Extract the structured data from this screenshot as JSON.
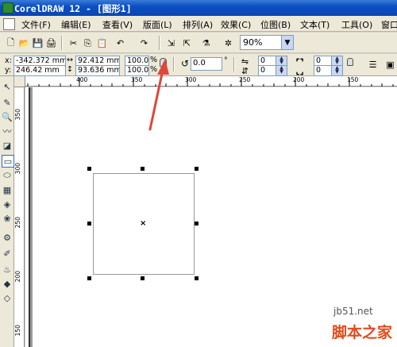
{
  "window": {
    "title": "CorelDRAW 12 - [图形1]"
  },
  "menu": [
    {
      "label": "文件(F)"
    },
    {
      "label": "编辑(E)"
    },
    {
      "label": "查看(V)"
    },
    {
      "label": "版面(L)"
    },
    {
      "label": "排列(A)"
    },
    {
      "label": "效果(C)"
    },
    {
      "label": "位图(B)"
    },
    {
      "label": "文本(T)"
    },
    {
      "label": "工具(O)"
    },
    {
      "label": "窗口"
    }
  ],
  "toolbar": {
    "icons": [
      "new-icon",
      "open-icon",
      "save-icon",
      "print-icon",
      "cut-icon",
      "copy-icon",
      "paste-icon",
      "undo-icon",
      "redo-icon",
      "import-icon",
      "export-icon",
      "app-launcher-icon",
      "corel-online-icon"
    ],
    "zoom": "90%"
  },
  "propbar": {
    "x_label": "x:",
    "x_value": "-342.372 mm",
    "y_label": "y:",
    "y_value": "246.42 mm",
    "w_value": "92.412 mm",
    "h_value": "93.636 mm",
    "scale_x": "100.0",
    "scale_y": "100.0",
    "percent_x": "%",
    "percent_y": "%",
    "rotate_value": "0.0",
    "degree": "°",
    "corner_tl": "0",
    "corner_bl": "0",
    "corner_tr": "0",
    "corner_br": "0"
  },
  "ruler_top": [
    "400",
    "350",
    "300",
    "250",
    "200",
    "150"
  ],
  "ruler_left": [
    "350",
    "300",
    "250",
    "200",
    "150"
  ],
  "watermark": {
    "site": "jb51.net",
    "name": "脚本之家"
  },
  "colors": {
    "titlebar": "#0b4fc2",
    "annotation_arrow": "#e0463c",
    "selection": "#316ac5"
  }
}
